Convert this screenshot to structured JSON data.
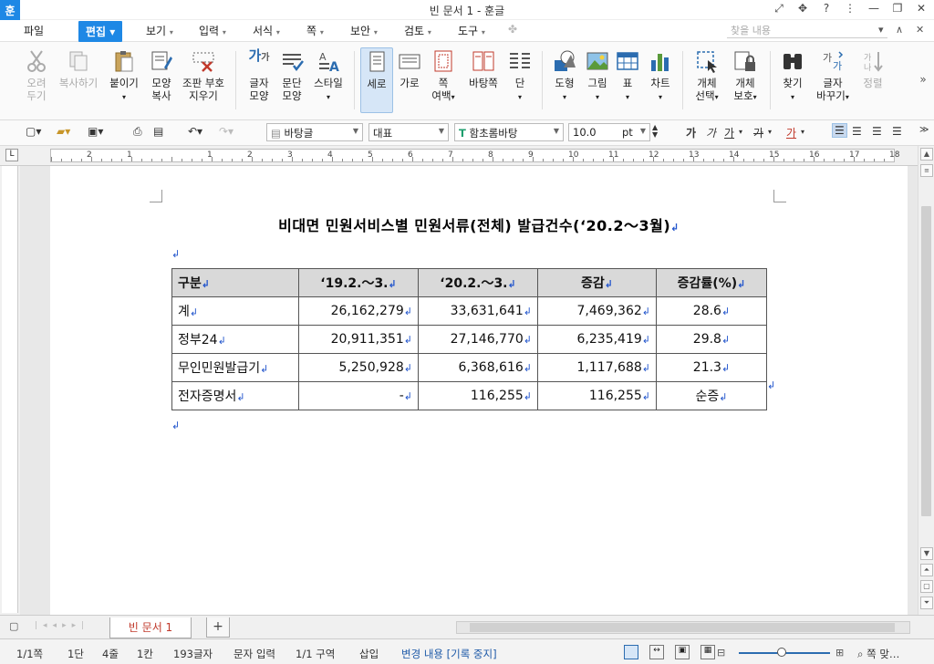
{
  "window": {
    "title": "빈 문서 1 - 훈글",
    "logo": "훈"
  },
  "menu": {
    "file": "파일",
    "items": [
      "편집",
      "보기",
      "입력",
      "서식",
      "쪽",
      "보안",
      "검토",
      "도구"
    ],
    "search_placeholder": "찾을 내용"
  },
  "ribbon": {
    "buttons": [
      {
        "label": "오려\n두기",
        "icon": "scissors-icon",
        "disabled": true
      },
      {
        "label": "복사하기",
        "icon": "copy-icon",
        "disabled": true
      },
      {
        "label": "붙이기",
        "icon": "paste-icon"
      },
      {
        "label": "모양\n복사",
        "icon": "format-painter-icon"
      },
      {
        "label": "조판 부호\n지우기",
        "icon": "clear-codes-icon"
      },
      {
        "label": "글자\n모양",
        "icon": "char-shape-icon"
      },
      {
        "label": "문단\n모양",
        "icon": "para-shape-icon"
      },
      {
        "label": "스타일",
        "icon": "style-icon"
      },
      {
        "label": "세로",
        "icon": "portrait-icon",
        "selected": true
      },
      {
        "label": "가로",
        "icon": "landscape-icon"
      },
      {
        "label": "쪽\n여백",
        "icon": "page-margin-icon"
      },
      {
        "label": "바탕쪽",
        "icon": "master-page-icon"
      },
      {
        "label": "단",
        "icon": "columns-icon"
      },
      {
        "label": "도형",
        "icon": "shape-icon"
      },
      {
        "label": "그림",
        "icon": "picture-icon"
      },
      {
        "label": "표",
        "icon": "table-icon"
      },
      {
        "label": "차트",
        "icon": "chart-icon"
      },
      {
        "label": "개체\n선택",
        "icon": "select-object-icon"
      },
      {
        "label": "개체\n보호",
        "icon": "protect-object-icon"
      },
      {
        "label": "찾기",
        "icon": "binoculars-icon"
      },
      {
        "label": "글자\n바꾸기",
        "icon": "replace-icon"
      },
      {
        "label": "정렬",
        "icon": "sort-icon",
        "disabled": true
      }
    ]
  },
  "format": {
    "style": "바탕글",
    "lang": "대표",
    "font": "함초롬바탕",
    "size": "10.0",
    "unit": "pt",
    "char_buttons": [
      "가",
      "가",
      "가",
      "가",
      "가"
    ]
  },
  "ruler": {
    "ticks": [
      "2",
      "1",
      "1",
      "2",
      "3",
      "4",
      "5",
      "6",
      "7",
      "8",
      "9",
      "10",
      "11",
      "12",
      "13",
      "14",
      "15",
      "16",
      "17",
      "18"
    ]
  },
  "document": {
    "title": "비대면 민원서비스별 민원서류(전체) 발급건수(‘20.2～3월)",
    "table": {
      "headers": [
        "구분",
        "‘19.2.～3.",
        "‘20.2.～3.",
        "증감",
        "증감률(%)"
      ],
      "rows": [
        [
          "계",
          "26,162,279",
          "33,631,641",
          "7,469,362",
          "28.6"
        ],
        [
          "정부24",
          "20,911,351",
          "27,146,770",
          "6,235,419",
          "29.8"
        ],
        [
          "무인민원발급기",
          "5,250,928",
          "6,368,616",
          "1,117,688",
          "21.3"
        ],
        [
          "전자증명서",
          "-",
          "116,255",
          "116,255",
          "순증"
        ]
      ]
    }
  },
  "tabs": {
    "doc_tab": "빈 문서 1"
  },
  "status": {
    "page": "1/1쪽",
    "column": "1단",
    "line": "4줄",
    "col": "1칸",
    "chars": "193글자",
    "input": "문자 입력",
    "section": "1/1 구역",
    "insert": "삽입",
    "track": "변경 내용 [기록 중지]",
    "zoom": "쪽 맞…"
  }
}
